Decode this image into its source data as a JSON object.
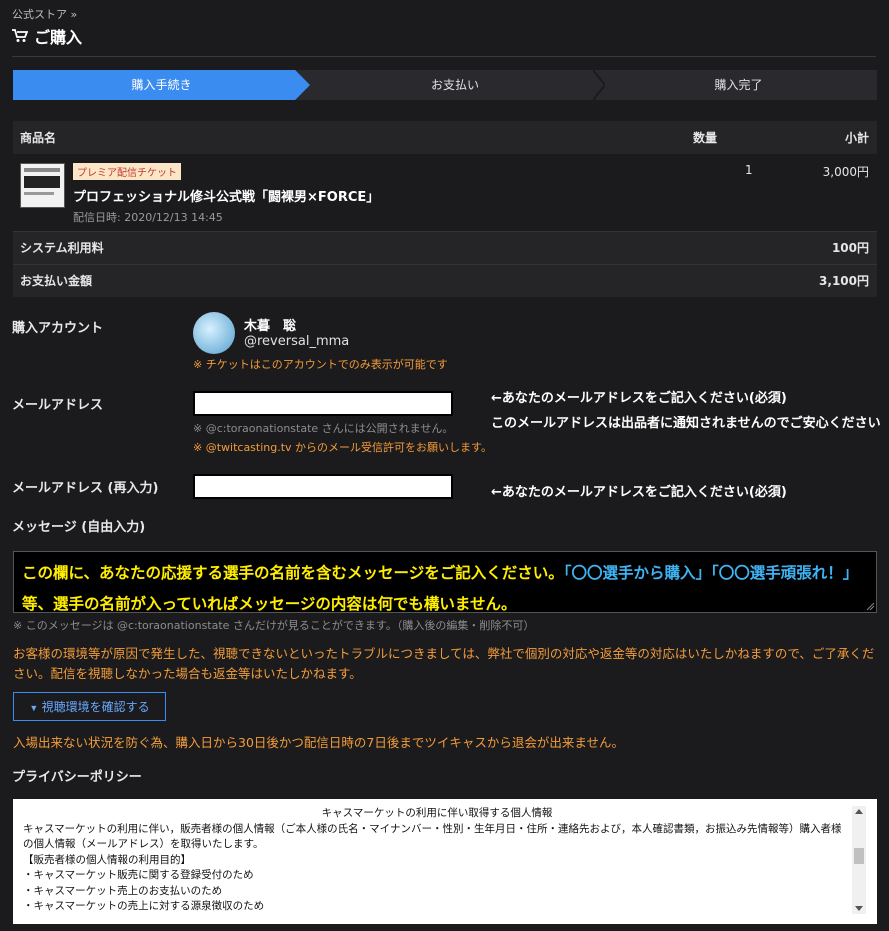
{
  "breadcrumb": "公式ストア »",
  "title": "ご購入",
  "steps": [
    "購入手続き",
    "お支払い",
    "購入完了"
  ],
  "table": {
    "headers": {
      "name": "商品名",
      "qty": "数量",
      "subtotal": "小計"
    },
    "item": {
      "badge": "プレミア配信チケット",
      "name": "プロフェッショナル修斗公式戦「闘裸男×FORCE」",
      "date": "配信日時: 2020/12/13 14:45",
      "qty": "1",
      "price": "3,000円"
    },
    "fee": {
      "label": "システム利用料",
      "value": "100円"
    },
    "total": {
      "label": "お支払い金額",
      "value": "3,100円"
    }
  },
  "account": {
    "label": "購入アカウント",
    "name": "木暮　聡",
    "handle": "@reversal_mma",
    "note": "※ チケットはこのアカウントでのみ表示が可能です"
  },
  "email": {
    "label": "メールアドレス",
    "value": "",
    "note1": "※ @c:toraonationstate さんには公開されません。",
    "note2": "※ @twitcasting.tv からのメール受信許可をお願いします。",
    "side1": "←あなたのメールアドレスをご記入ください(必須)",
    "side2": "このメールアドレスは出品者に通知されませんのでご安心ください"
  },
  "email_confirm": {
    "label": "メールアドレス (再入力)",
    "value": "",
    "side": "←あなたのメールアドレスをご記入ください(必須)"
  },
  "message": {
    "label": "メッセージ (自由入力)",
    "text_part1": "この欄に、あなたの応援する選手の名前を含むメッセージをご記入ください。",
    "text_blue": "「〇〇選手から購入」「〇〇選手頑張れ！」",
    "text_part2": "等、選手の名前が入っていればメッセージの内容は何でも構いません。",
    "note": "※ このメッセージは @c:toraonationstate さんだけが見ることができます。（購入後の編集・削除不可）"
  },
  "warning": "お客様の環境等が原因で発生した、視聴できないといったトラブルにつきましては、弊社で個別の対応や返金等の対応はいたしかねますので、ご了承ください。配信を視聴しなかった場合も返金等はいたしかねます。",
  "env_button": "視聴環境を確認する",
  "withdraw_note": "入場出来ない状況を防ぐ為、購入日から30日後かつ配信日時の7日後までツイキャスから退会が出来ません。",
  "privacy": {
    "label": "プライバシーポリシー",
    "heading": "キャスマーケットの利用に伴い取得する個人情報",
    "lines": [
      "キャスマーケットの利用に伴い，販売者様の個人情報（ご本人様の氏名・マイナンバー・性別・生年月日・住所・連絡先および，本人確認書類，お振込み先情報等）購入者様の個人情報（メールアドレス）を取得いたします。",
      "【販売者様の個人情報の利用目的】",
      "・キャスマーケット販売に関する登録受付のため",
      "・キャスマーケット売上のお支払いのため",
      "・キャスマーケットの売上に対する源泉徴収のため"
    ]
  }
}
